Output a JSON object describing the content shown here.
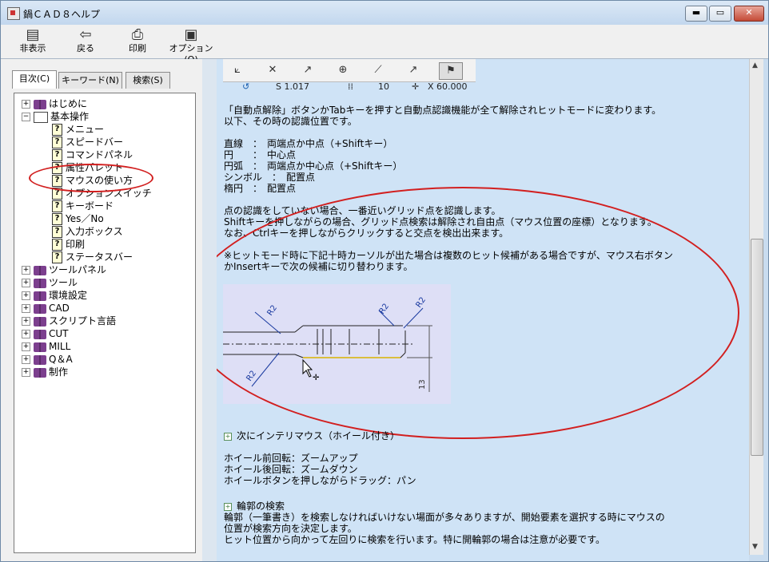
{
  "window": {
    "title": "鍋ＣＡＤ８ヘルプ"
  },
  "titlebar_buttons": {
    "minimize": "▬",
    "restore": "▭",
    "close": "✕"
  },
  "toolbar": {
    "hide_label": "非表示",
    "back_label": "戻る",
    "print_label": "印刷",
    "options_label": "オプション(O)"
  },
  "tabs": [
    {
      "label": "目次(C)"
    },
    {
      "label": "キーワード(N)"
    },
    {
      "label": "検索(S)"
    }
  ],
  "tree": {
    "items": [
      {
        "label": "はじめに",
        "type": "book",
        "expander": "+"
      },
      {
        "label": "基本操作",
        "type": "openbook",
        "expander": "−"
      },
      {
        "label": "メニュー",
        "type": "page"
      },
      {
        "label": "スピードバー",
        "type": "page"
      },
      {
        "label": "コマンドパネル",
        "type": "page"
      },
      {
        "label": "属性パレット",
        "type": "page"
      },
      {
        "label": "マウスの使い方",
        "type": "page"
      },
      {
        "label": "オプションスイッチ",
        "type": "page"
      },
      {
        "label": "キーボード",
        "type": "page"
      },
      {
        "label": "Yes／No",
        "type": "page"
      },
      {
        "label": "入力ボックス",
        "type": "page"
      },
      {
        "label": "印刷",
        "type": "page"
      },
      {
        "label": "ステータスバー",
        "type": "page"
      },
      {
        "label": "ツールパネル",
        "type": "book",
        "expander": "+"
      },
      {
        "label": "ツール",
        "type": "book",
        "expander": "+"
      },
      {
        "label": "環境設定",
        "type": "book",
        "expander": "+"
      },
      {
        "label": "CAD",
        "type": "book",
        "expander": "+"
      },
      {
        "label": "スクリプト言語",
        "type": "book",
        "expander": "+"
      },
      {
        "label": "CUT",
        "type": "book",
        "expander": "+"
      },
      {
        "label": "MILL",
        "type": "book",
        "expander": "+"
      },
      {
        "label": "Q＆A",
        "type": "book",
        "expander": "+"
      },
      {
        "label": "制作",
        "type": "book",
        "expander": "+"
      }
    ]
  },
  "content": {
    "mini_status": {
      "s_value": "S 1.017",
      "count": "10",
      "x_value": "X 60.000"
    },
    "p1_line1": "「自動点解除」ボタンかTabキーを押すと自動点認識機能が全て解除されヒットモードに変わります。",
    "p1_line2": "以下、その時の認識位置です。",
    "p2_line1": "直線　：　両端点か中点（+Shiftキー）",
    "p2_line2": "円　　：　中心点",
    "p2_line3": "円弧　：　両端点か中心点（+Shiftキー）",
    "p2_line4": "シンボル　：　配置点",
    "p2_line5": "楕円　：　配置点",
    "p3_line1": "点の認識をしていない場合、一番近いグリッド点を認識します。",
    "p3_line2": "Shiftキーを押しながらの場合、グリッド点検索は解除され自由点（マウス位置の座標）となります。",
    "p3_line3": "なお、Ctrlキーを押しながらクリックすると交点を検出出来ます。",
    "p4_line1": "※ヒットモード時に下記十時カーソルが出た場合は複数のヒット候補がある場合ですが、マウス右ボタン",
    "p4_line2": "かInsertキーで次の候補に切り替わります。",
    "figure_labels": {
      "r2": "R2",
      "dim13": "13"
    },
    "section_wheel": "次にインテリマウス（ホイール付き）",
    "wheel_line1": "ホイール前回転：ズームアップ",
    "wheel_line2": "ホイール後回転：ズームダウン",
    "wheel_line3": "ホイールボタンを押しながらドラッグ：パン",
    "section_contour": "輪郭の検索",
    "contour_line1": "輪郭（一筆書き）を検索しなければいけない場面が多々ありますが、開始要素を選択する時にマウスの",
    "contour_line2": "位置が検索方向を決定します。",
    "contour_line3": "ヒット位置から向かって左回りに検索を行います。特に開輪郭の場合は注意が必要です。"
  },
  "colors": {
    "annotation": "#d21f1f",
    "content_bg": "#cfe3f6"
  }
}
